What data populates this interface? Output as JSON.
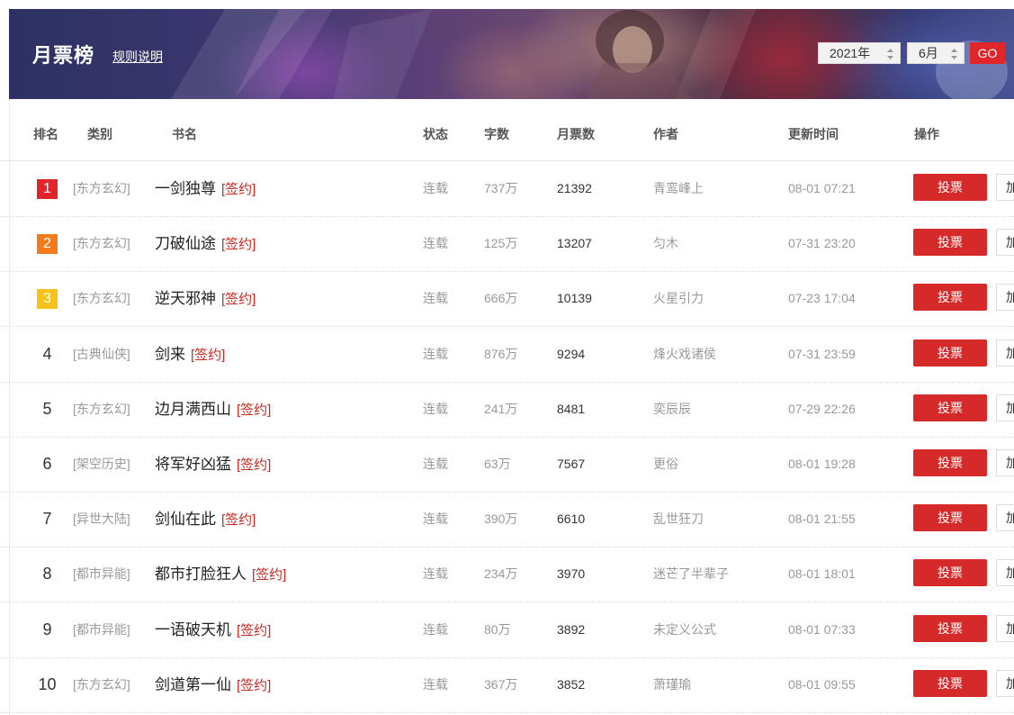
{
  "header": {
    "title": "月票榜",
    "rules_link": "规则说明",
    "year_select": "2021年",
    "month_select": "6月",
    "go_label": "GO"
  },
  "table": {
    "columns": {
      "rank": "排名",
      "category": "类别",
      "title": "书名",
      "status": "状态",
      "words": "字数",
      "votes": "月票数",
      "author": "作者",
      "updated": "更新时间",
      "action": "操作"
    },
    "rows": [
      {
        "rank": "1",
        "category": "[东方玄幻]",
        "title": "一剑独尊",
        "tag": "[签约]",
        "status": "连载",
        "words": "737万",
        "votes": "21392",
        "author": "青鸾峰上",
        "updated": "08-01 07:21",
        "vote_label": "投票",
        "add_label": "加"
      },
      {
        "rank": "2",
        "category": "[东方玄幻]",
        "title": "刀破仙途",
        "tag": "[签约]",
        "status": "连载",
        "words": "125万",
        "votes": "13207",
        "author": "匀木",
        "updated": "07-31 23:20",
        "vote_label": "投票",
        "add_label": "加"
      },
      {
        "rank": "3",
        "category": "[东方玄幻]",
        "title": "逆天邪神",
        "tag": "[签约]",
        "status": "连载",
        "words": "666万",
        "votes": "10139",
        "author": "火星引力",
        "updated": "07-23 17:04",
        "vote_label": "投票",
        "add_label": "加"
      },
      {
        "rank": "4",
        "category": "[古典仙侠]",
        "title": "剑来",
        "tag": "[签约]",
        "status": "连载",
        "words": "876万",
        "votes": "9294",
        "author": "烽火戏诸侯",
        "updated": "07-31 23:59",
        "vote_label": "投票",
        "add_label": "加"
      },
      {
        "rank": "5",
        "category": "[东方玄幻]",
        "title": "边月满西山",
        "tag": "[签约]",
        "status": "连载",
        "words": "241万",
        "votes": "8481",
        "author": "奕辰辰",
        "updated": "07-29 22:26",
        "vote_label": "投票",
        "add_label": "加"
      },
      {
        "rank": "6",
        "category": "[架空历史]",
        "title": "将军好凶猛",
        "tag": "[签约]",
        "status": "连载",
        "words": "63万",
        "votes": "7567",
        "author": "更俗",
        "updated": "08-01 19:28",
        "vote_label": "投票",
        "add_label": "加"
      },
      {
        "rank": "7",
        "category": "[异世大陆]",
        "title": "剑仙在此",
        "tag": "[签约]",
        "status": "连载",
        "words": "390万",
        "votes": "6610",
        "author": "乱世狂刀",
        "updated": "08-01 21:55",
        "vote_label": "投票",
        "add_label": "加"
      },
      {
        "rank": "8",
        "category": "[都市异能]",
        "title": "都市打脸狂人",
        "tag": "[签约]",
        "status": "连载",
        "words": "234万",
        "votes": "3970",
        "author": "迷芒了半辈子",
        "updated": "08-01 18:01",
        "vote_label": "投票",
        "add_label": "加"
      },
      {
        "rank": "9",
        "category": "[都市异能]",
        "title": "一语破天机",
        "tag": "[签约]",
        "status": "连载",
        "words": "80万",
        "votes": "3892",
        "author": "未定义公式",
        "updated": "08-01 07:33",
        "vote_label": "投票",
        "add_label": "加"
      },
      {
        "rank": "10",
        "category": "[东方玄幻]",
        "title": "剑道第一仙",
        "tag": "[签约]",
        "status": "连载",
        "words": "367万",
        "votes": "3852",
        "author": "萧瑾瑜",
        "updated": "08-01 09:55",
        "vote_label": "投票",
        "add_label": "加"
      }
    ]
  },
  "colors": {
    "rank1": "#e0252b",
    "rank2": "#f27c1b",
    "rank3": "#f7c21a",
    "vote_button": "#d62a2a"
  }
}
